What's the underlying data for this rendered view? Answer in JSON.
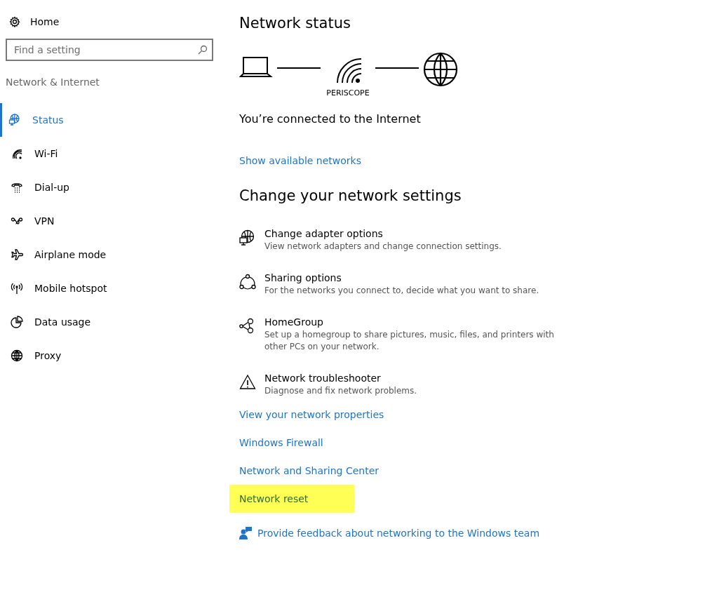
{
  "sidebar": {
    "home": "Home",
    "search": {
      "placeholder": "Find a setting"
    },
    "section": "Network & Internet",
    "items": [
      {
        "label": "Status",
        "selected": true
      },
      {
        "label": "Wi-Fi",
        "selected": false
      },
      {
        "label": "Dial-up",
        "selected": false
      },
      {
        "label": "VPN",
        "selected": false
      },
      {
        "label": "Airplane mode",
        "selected": false
      },
      {
        "label": "Mobile hotspot",
        "selected": false
      },
      {
        "label": "Data usage",
        "selected": false
      },
      {
        "label": "Proxy",
        "selected": false
      }
    ]
  },
  "main": {
    "title": "Network status",
    "network_name": "PERISCOPE",
    "status": "You’re connected to the Internet",
    "show_link": "Show available networks",
    "settings_title": "Change your network settings",
    "options": [
      {
        "title": "Change adapter options",
        "description": "View network adapters and change connection settings."
      },
      {
        "title": "Sharing options",
        "description": "For the networks you connect to, decide what you want to share."
      },
      {
        "title": "HomeGroup",
        "description": "Set up a homegroup to share pictures, music, files, and printers with other PCs on your network."
      },
      {
        "title": "Network troubleshooter",
        "description": "Diagnose and fix network problems."
      }
    ],
    "links": [
      {
        "label": "View your network properties",
        "highlighted": false
      },
      {
        "label": "Windows Firewall",
        "highlighted": false
      },
      {
        "label": "Network and Sharing Center",
        "highlighted": false
      },
      {
        "label": "Network reset",
        "highlighted": true
      }
    ],
    "feedback": "Provide feedback about networking to the Windows team"
  }
}
